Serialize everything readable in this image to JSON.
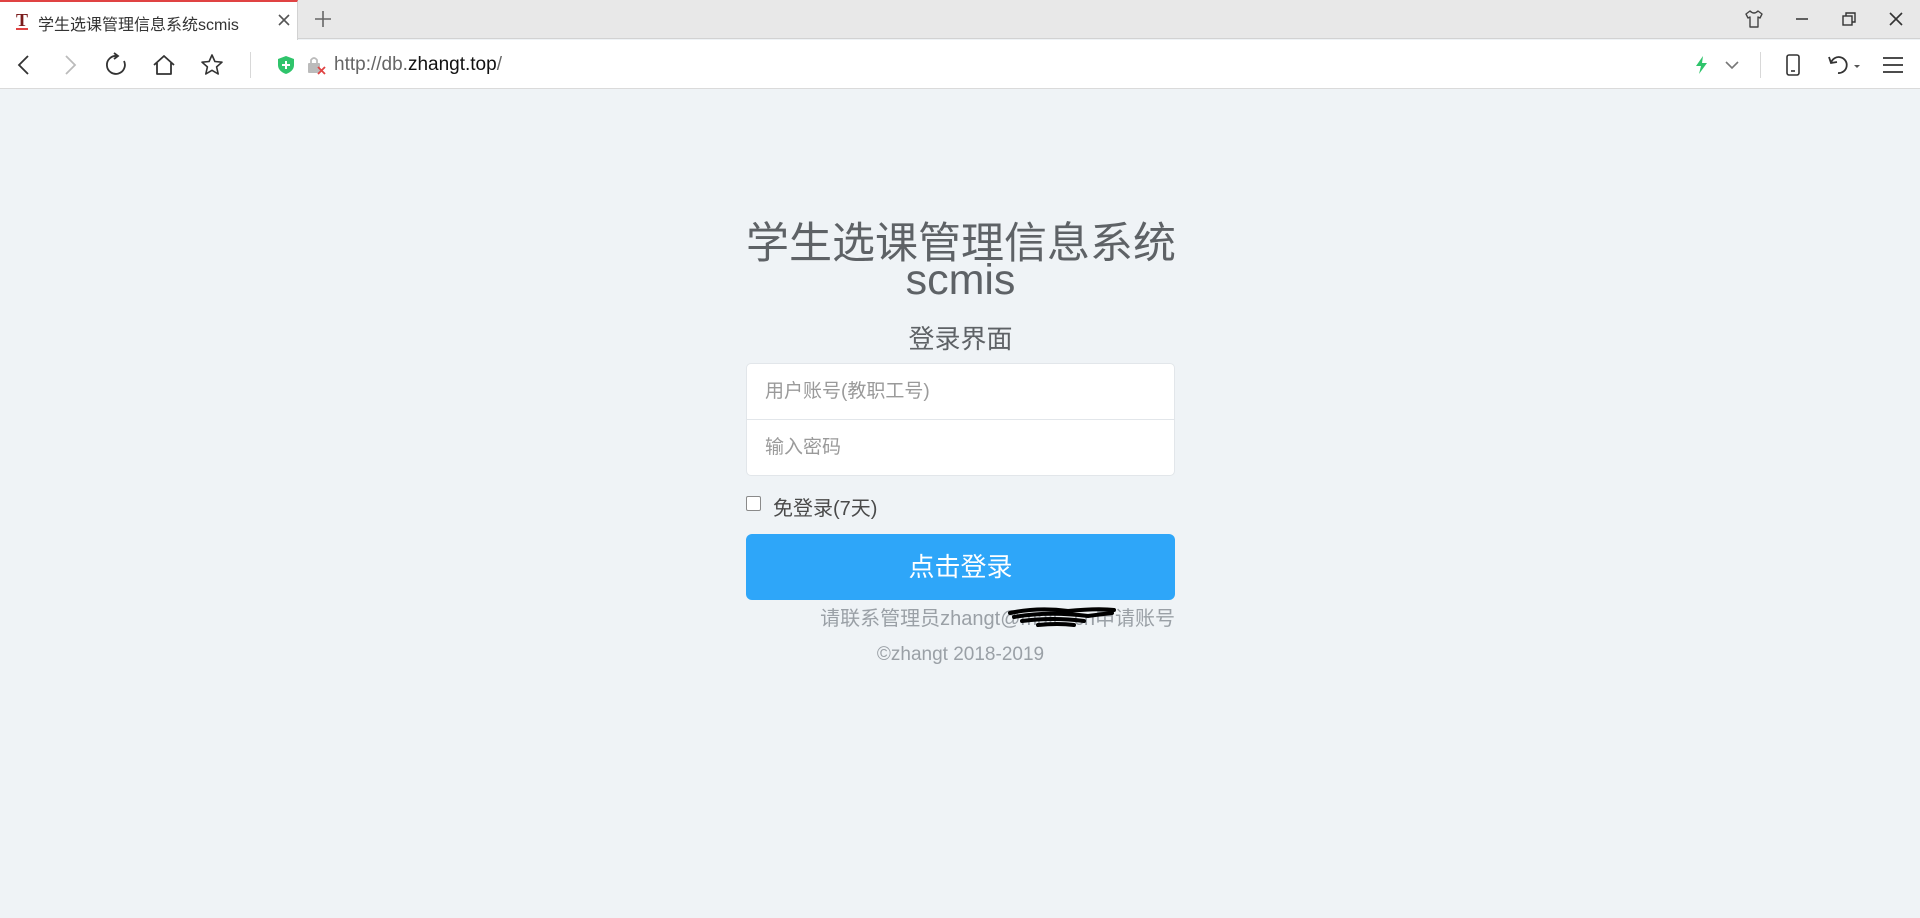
{
  "browser": {
    "tab_title": "学生选课管理信息系统scmis",
    "tab_favicon": "T",
    "url_prefix": "http://db.",
    "url_domain": "zhangt.top",
    "url_suffix": "/"
  },
  "icons": {
    "back": "back-arrow-icon",
    "forward": "forward-arrow-icon",
    "reload": "reload-icon",
    "home": "home-icon",
    "bookmark": "star-icon",
    "shield": "shield-icon",
    "insecure": "insecure-lock-icon",
    "bolt": "lightning-icon",
    "dropdown": "chevron-down-icon",
    "mobile": "mobile-device-icon",
    "undo": "undo-icon",
    "menu": "hamburger-menu-icon",
    "skin": "shirt-icon"
  },
  "login": {
    "title_line1": "学生选课管理信息系统",
    "title_line2": "scmis",
    "subtitle": "登录界面",
    "username_placeholder": "用户账号(教职工号)",
    "password_placeholder": "输入密码",
    "remember_label": "免登录(7天)",
    "remember_checked": false,
    "submit_label": "点击登录",
    "contact_text": "请联系管理员zhangt@mail.         .cn申请账号",
    "copyright": "©zhangt 2018-2019"
  },
  "colors": {
    "page_bg": "#eff3f6",
    "button_bg": "#2ea6f9",
    "title_text": "#5e6266",
    "muted_text": "#9aa0a6",
    "shield_green": "#2fc46b"
  }
}
